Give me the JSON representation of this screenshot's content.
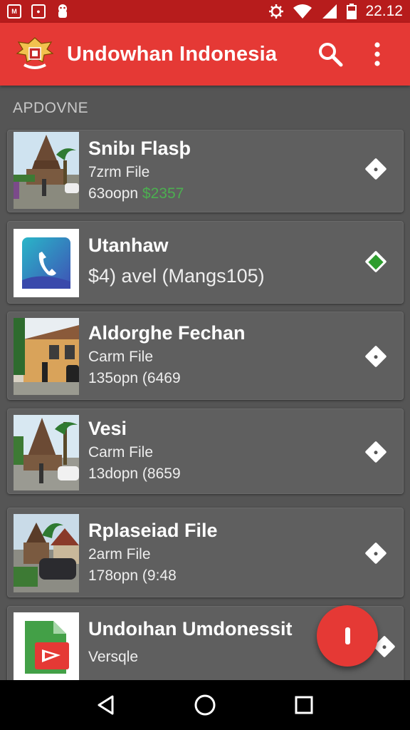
{
  "status_bar": {
    "time": "22.12",
    "left_icons": [
      "image-icon",
      "portrait-icon",
      "android-icon"
    ],
    "right_icons": [
      "settings-icon",
      "wifi-icon",
      "signal-icon",
      "battery-icon"
    ]
  },
  "app_bar": {
    "title": "Undowhan Indonesia",
    "logo_icon": "garuda-emblem-icon",
    "actions": [
      "search-icon",
      "more-vert-icon"
    ],
    "color": "#e53935"
  },
  "section": {
    "header": "APDOVNE"
  },
  "items": [
    {
      "title": "Snibı Flasþ",
      "line1": "7zrm File",
      "line2_prefix": "63oopn ",
      "line2_highlight": "$2357",
      "thumb": "temple-photo",
      "action": "diamond-icon"
    },
    {
      "title": "Utanhaw",
      "line1": "$4) avel (Mangs105)",
      "thumb": "phone-app-icon",
      "action": "diamond-green-icon"
    },
    {
      "title": "Aldorghe Fechan",
      "line1": "Carm File",
      "line2_prefix": "135opn (6469",
      "thumb": "building-photo",
      "action": "diamond-icon"
    },
    {
      "title": "Vesi",
      "line1": "Carm File",
      "line2_prefix": "13dopn (8659",
      "thumb": "temple-photo",
      "action": "diamond-icon"
    },
    {
      "title": "Rplaseiad File",
      "line1": "2arm File",
      "line2_prefix": "178opn (9:48",
      "thumb": "house-photo",
      "action": "diamond-icon"
    },
    {
      "title": "Undoıhan Umdonessit",
      "line1": "Versqle",
      "thumb": "file-app-icon",
      "action": "diamond-icon"
    }
  ],
  "accent_green": "#4caf50",
  "fab": {
    "icon": "fab-icon"
  },
  "nav": [
    "back-icon",
    "home-icon",
    "recents-icon"
  ]
}
